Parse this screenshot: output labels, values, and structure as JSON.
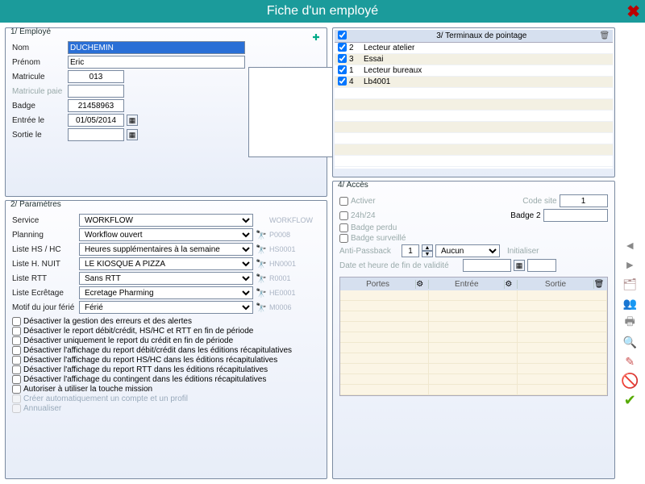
{
  "title": "Fiche d'un employé",
  "panel_labels": {
    "employe": "1/ Employé",
    "parametres": "2/ Paramètres",
    "terminaux": "3/ Terminaux de pointage",
    "acces": "4/ Accès"
  },
  "employe": {
    "nom_lbl": "Nom",
    "nom": "DUCHEMIN",
    "prenom_lbl": "Prénom",
    "prenom": "Eric",
    "matricule_lbl": "Matricule",
    "matricule": "013",
    "matpaie_lbl": "Matricule paie",
    "matpaie": "",
    "badge_lbl": "Badge",
    "badge": "21458963",
    "entree_lbl": "Entrée le",
    "entree": "01/05/2014",
    "sortie_lbl": "Sortie le",
    "sortie": ""
  },
  "parametres": {
    "rows": [
      {
        "label": "Service",
        "value": "WORKFLOW",
        "code": "WORKFLOW",
        "binoc": false
      },
      {
        "label": "Planning",
        "value": "Workflow ouvert",
        "code": "P0008",
        "binoc": true
      },
      {
        "label": "Liste HS / HC",
        "value": "Heures supplémentaires à la semaine",
        "code": "HS0001",
        "binoc": true
      },
      {
        "label": "Liste H. NUIT",
        "value": "LE KIOSQUE A PIZZA",
        "code": "HN0001",
        "binoc": true
      },
      {
        "label": "Liste RTT",
        "value": "Sans RTT",
        "code": "R0001",
        "binoc": true
      },
      {
        "label": "Liste Ecrêtage",
        "value": "Ecretage Pharming",
        "code": "HE0001",
        "binoc": true
      },
      {
        "label": "Motif du jour férié",
        "value": "Férié",
        "code": "M0006",
        "binoc": true
      }
    ],
    "checks": [
      "Désactiver la gestion des erreurs et des alertes",
      "Désactiver le report débit/crédit, HS/HC et RTT en fin de période",
      "Désactiver uniquement le report du crédit en fin de période",
      "Désactiver l'affichage du report débit/crédit dans les éditions récapitulatives",
      "Désactiver l'affichage du report HS/HC dans les éditions récapitulatives",
      "Désactiver l'affichage du report RTT dans les éditions récapitulatives",
      "Désactiver l'affichage du contingent dans les éditions récapitulatives",
      "Autoriser à utiliser la touche mission"
    ],
    "checks_disabled": [
      "Créer automatiquement un compte et un profil",
      "Annualiser"
    ]
  },
  "terminaux": {
    "rows": [
      {
        "chk": true,
        "num": "2",
        "name": "Lecteur atelier"
      },
      {
        "chk": true,
        "num": "3",
        "name": "Essai"
      },
      {
        "chk": true,
        "num": "1",
        "name": "Lecteur bureaux"
      },
      {
        "chk": true,
        "num": "4",
        "name": "Lb4001"
      }
    ]
  },
  "acces": {
    "activer": "Activer",
    "code_site_lbl": "Code site",
    "code_site": "1",
    "h24": "24h/24",
    "badge2_lbl": "Badge 2",
    "badge2": "",
    "perdu": "Badge perdu",
    "surv": "Badge surveillé",
    "apb_lbl": "Anti-Passback",
    "apb_num": "1",
    "apb_sel": "Aucun",
    "init": "Initialiser",
    "datefin": "Date et heure de fin de validité",
    "cols": {
      "portes": "Portes",
      "entree": "Entrée",
      "sortie": "Sortie"
    }
  },
  "icons": {
    "add": "✚",
    "remove": "—",
    "cal": "▦",
    "del": "🗑",
    "left": "◄",
    "right": "►",
    "people": "👥",
    "search": "🔍",
    "pen": "✎",
    "no": "🚫",
    "ok": "✔",
    "up": "▲",
    "dn": "▼",
    "print": "🖶",
    "binoc": "🔭"
  }
}
